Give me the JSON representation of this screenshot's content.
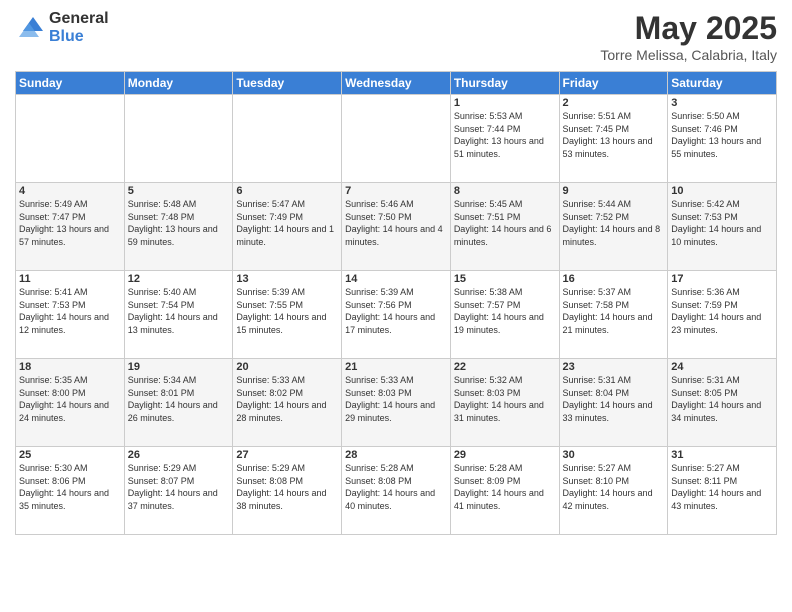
{
  "logo": {
    "general": "General",
    "blue": "Blue"
  },
  "title": "May 2025",
  "subtitle": "Torre Melissa, Calabria, Italy",
  "days": [
    "Sunday",
    "Monday",
    "Tuesday",
    "Wednesday",
    "Thursday",
    "Friday",
    "Saturday"
  ],
  "weeks": [
    [
      {
        "day": "",
        "info": ""
      },
      {
        "day": "",
        "info": ""
      },
      {
        "day": "",
        "info": ""
      },
      {
        "day": "",
        "info": ""
      },
      {
        "day": "1",
        "info": "Sunrise: 5:53 AM\nSunset: 7:44 PM\nDaylight: 13 hours and 51 minutes."
      },
      {
        "day": "2",
        "info": "Sunrise: 5:51 AM\nSunset: 7:45 PM\nDaylight: 13 hours and 53 minutes."
      },
      {
        "day": "3",
        "info": "Sunrise: 5:50 AM\nSunset: 7:46 PM\nDaylight: 13 hours and 55 minutes."
      }
    ],
    [
      {
        "day": "4",
        "info": "Sunrise: 5:49 AM\nSunset: 7:47 PM\nDaylight: 13 hours and 57 minutes."
      },
      {
        "day": "5",
        "info": "Sunrise: 5:48 AM\nSunset: 7:48 PM\nDaylight: 13 hours and 59 minutes."
      },
      {
        "day": "6",
        "info": "Sunrise: 5:47 AM\nSunset: 7:49 PM\nDaylight: 14 hours and 1 minute."
      },
      {
        "day": "7",
        "info": "Sunrise: 5:46 AM\nSunset: 7:50 PM\nDaylight: 14 hours and 4 minutes."
      },
      {
        "day": "8",
        "info": "Sunrise: 5:45 AM\nSunset: 7:51 PM\nDaylight: 14 hours and 6 minutes."
      },
      {
        "day": "9",
        "info": "Sunrise: 5:44 AM\nSunset: 7:52 PM\nDaylight: 14 hours and 8 minutes."
      },
      {
        "day": "10",
        "info": "Sunrise: 5:42 AM\nSunset: 7:53 PM\nDaylight: 14 hours and 10 minutes."
      }
    ],
    [
      {
        "day": "11",
        "info": "Sunrise: 5:41 AM\nSunset: 7:53 PM\nDaylight: 14 hours and 12 minutes."
      },
      {
        "day": "12",
        "info": "Sunrise: 5:40 AM\nSunset: 7:54 PM\nDaylight: 14 hours and 13 minutes."
      },
      {
        "day": "13",
        "info": "Sunrise: 5:39 AM\nSunset: 7:55 PM\nDaylight: 14 hours and 15 minutes."
      },
      {
        "day": "14",
        "info": "Sunrise: 5:39 AM\nSunset: 7:56 PM\nDaylight: 14 hours and 17 minutes."
      },
      {
        "day": "15",
        "info": "Sunrise: 5:38 AM\nSunset: 7:57 PM\nDaylight: 14 hours and 19 minutes."
      },
      {
        "day": "16",
        "info": "Sunrise: 5:37 AM\nSunset: 7:58 PM\nDaylight: 14 hours and 21 minutes."
      },
      {
        "day": "17",
        "info": "Sunrise: 5:36 AM\nSunset: 7:59 PM\nDaylight: 14 hours and 23 minutes."
      }
    ],
    [
      {
        "day": "18",
        "info": "Sunrise: 5:35 AM\nSunset: 8:00 PM\nDaylight: 14 hours and 24 minutes."
      },
      {
        "day": "19",
        "info": "Sunrise: 5:34 AM\nSunset: 8:01 PM\nDaylight: 14 hours and 26 minutes."
      },
      {
        "day": "20",
        "info": "Sunrise: 5:33 AM\nSunset: 8:02 PM\nDaylight: 14 hours and 28 minutes."
      },
      {
        "day": "21",
        "info": "Sunrise: 5:33 AM\nSunset: 8:03 PM\nDaylight: 14 hours and 29 minutes."
      },
      {
        "day": "22",
        "info": "Sunrise: 5:32 AM\nSunset: 8:03 PM\nDaylight: 14 hours and 31 minutes."
      },
      {
        "day": "23",
        "info": "Sunrise: 5:31 AM\nSunset: 8:04 PM\nDaylight: 14 hours and 33 minutes."
      },
      {
        "day": "24",
        "info": "Sunrise: 5:31 AM\nSunset: 8:05 PM\nDaylight: 14 hours and 34 minutes."
      }
    ],
    [
      {
        "day": "25",
        "info": "Sunrise: 5:30 AM\nSunset: 8:06 PM\nDaylight: 14 hours and 35 minutes."
      },
      {
        "day": "26",
        "info": "Sunrise: 5:29 AM\nSunset: 8:07 PM\nDaylight: 14 hours and 37 minutes."
      },
      {
        "day": "27",
        "info": "Sunrise: 5:29 AM\nSunset: 8:08 PM\nDaylight: 14 hours and 38 minutes."
      },
      {
        "day": "28",
        "info": "Sunrise: 5:28 AM\nSunset: 8:08 PM\nDaylight: 14 hours and 40 minutes."
      },
      {
        "day": "29",
        "info": "Sunrise: 5:28 AM\nSunset: 8:09 PM\nDaylight: 14 hours and 41 minutes."
      },
      {
        "day": "30",
        "info": "Sunrise: 5:27 AM\nSunset: 8:10 PM\nDaylight: 14 hours and 42 minutes."
      },
      {
        "day": "31",
        "info": "Sunrise: 5:27 AM\nSunset: 8:11 PM\nDaylight: 14 hours and 43 minutes."
      }
    ]
  ]
}
